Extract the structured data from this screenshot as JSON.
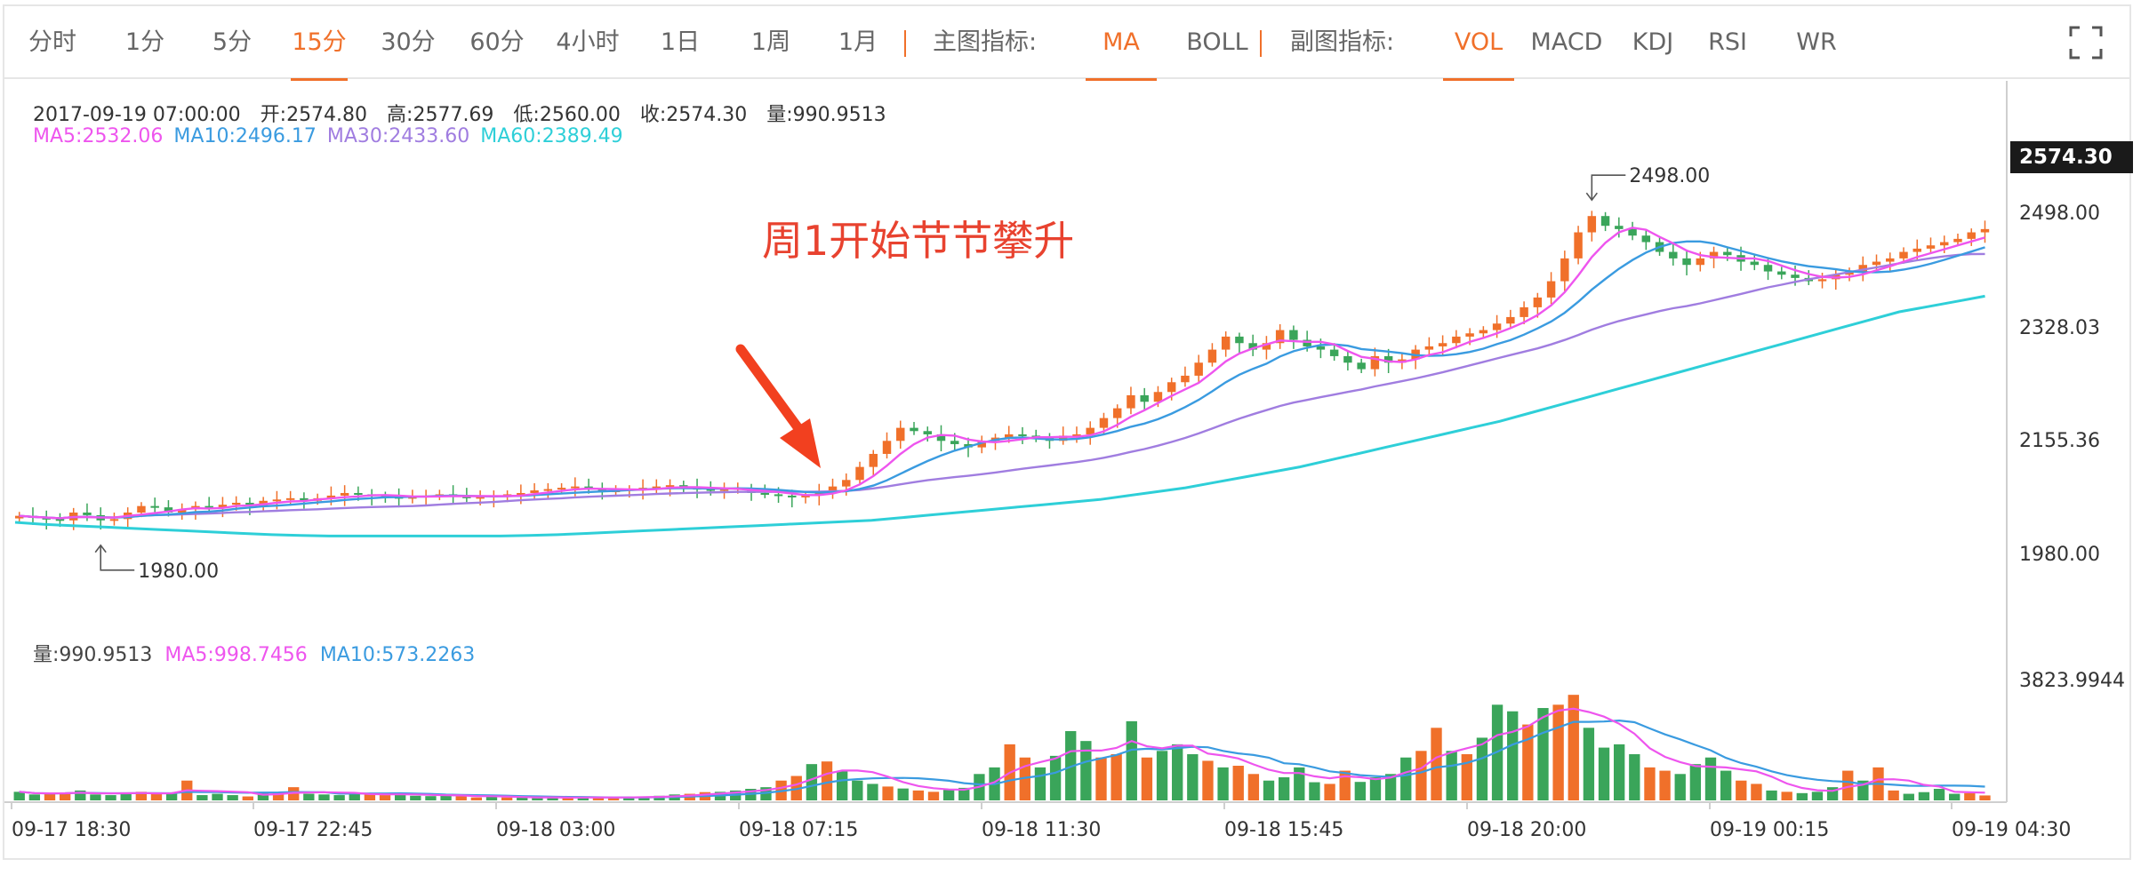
{
  "toolbar": {
    "periods": [
      {
        "label": "分时",
        "active": false
      },
      {
        "label": "1分",
        "active": false
      },
      {
        "label": "5分",
        "active": false
      },
      {
        "label": "15分",
        "active": true
      },
      {
        "label": "30分",
        "active": false
      },
      {
        "label": "60分",
        "active": false
      },
      {
        "label": "4小时",
        "active": false
      },
      {
        "label": "1日",
        "active": false
      },
      {
        "label": "1周",
        "active": false
      },
      {
        "label": "1月",
        "active": false
      }
    ],
    "main_indicator_label": "主图指标:",
    "main_indicators": [
      {
        "label": "MA",
        "active": true
      },
      {
        "label": "BOLL",
        "active": false
      }
    ],
    "sub_indicator_label": "副图指标:",
    "sub_indicators": [
      {
        "label": "VOL",
        "active": true
      },
      {
        "label": "MACD",
        "active": false
      },
      {
        "label": "KDJ",
        "active": false
      },
      {
        "label": "RSI",
        "active": false
      },
      {
        "label": "WR",
        "active": false
      }
    ],
    "fullscreen_icon": "expand-icon"
  },
  "info": {
    "line1": "2017-09-19 07:00:00　开:2574.80　高:2577.69　低:2560.00　收:2574.30　量:990.9513",
    "ma": [
      {
        "text": "MA5:2532.06",
        "color": "#ee55ee"
      },
      {
        "text": "MA10:2496.17",
        "color": "#3a9be0"
      },
      {
        "text": "MA30:2433.60",
        "color": "#a07de0"
      },
      {
        "text": "MA60:2389.49",
        "color": "#2ecfd8"
      }
    ],
    "vol": [
      {
        "text": "量:990.9513",
        "color": "#444444"
      },
      {
        "text": "MA5:998.7456",
        "color": "#ee55ee"
      },
      {
        "text": "MA10:573.2263",
        "color": "#3a9be0"
      }
    ]
  },
  "annotation": "周1开始节节攀升",
  "colors": {
    "up": "#f0702a",
    "down": "#3aa55a",
    "accent": "#f0702a",
    "arrow": "#f2401f",
    "price_tag_bg": "#1a1a1a"
  },
  "chart_data": {
    "type": "candlestick",
    "symbol_interval": "15分",
    "price_axis": {
      "ticks": [
        "2498.00",
        "2328.03",
        "2155.36",
        "1980.00"
      ],
      "current_price": "2574.30",
      "ylim": [
        1980,
        2498
      ]
    },
    "volume_axis": {
      "ticks": [
        "3823.9944"
      ],
      "ylim": [
        0,
        3823.9944
      ]
    },
    "x_ticks": [
      "09-17 18:30",
      "09-17 22:45",
      "09-18 03:00",
      "09-18 07:15",
      "09-18 11:30",
      "09-18 15:45",
      "09-18 20:00",
      "09-19 00:15",
      "09-19 04:30"
    ],
    "markers": {
      "high": "2498.00",
      "low": "1980.00"
    },
    "close_series": [
      2035,
      2032,
      2030,
      2028,
      2040,
      2036,
      2028,
      2030,
      2040,
      2050,
      2048,
      2040,
      2045,
      2050,
      2048,
      2052,
      2055,
      2050,
      2058,
      2060,
      2062,
      2058,
      2062,
      2066,
      2070,
      2068,
      2066,
      2064,
      2062,
      2064,
      2066,
      2068,
      2066,
      2062,
      2064,
      2066,
      2068,
      2070,
      2074,
      2076,
      2078,
      2080,
      2076,
      2072,
      2074,
      2076,
      2078,
      2080,
      2082,
      2078,
      2076,
      2074,
      2076,
      2078,
      2070,
      2068,
      2066,
      2064,
      2066,
      2070,
      2080,
      2090,
      2110,
      2130,
      2150,
      2170,
      2165,
      2160,
      2150,
      2145,
      2140,
      2150,
      2155,
      2160,
      2158,
      2155,
      2150,
      2158,
      2160,
      2170,
      2185,
      2200,
      2220,
      2210,
      2225,
      2240,
      2250,
      2270,
      2290,
      2310,
      2300,
      2290,
      2300,
      2320,
      2305,
      2295,
      2290,
      2280,
      2270,
      2260,
      2280,
      2270,
      2275,
      2290,
      2295,
      2300,
      2310,
      2315,
      2320,
      2330,
      2340,
      2355,
      2370,
      2395,
      2430,
      2470,
      2495,
      2480,
      2475,
      2465,
      2455,
      2440,
      2430,
      2420,
      2430,
      2440,
      2435,
      2425,
      2420,
      2410,
      2405,
      2400,
      2395,
      2398,
      2405,
      2410,
      2420,
      2425,
      2430,
      2440,
      2445,
      2450,
      2455,
      2460,
      2470,
      2475
    ],
    "ma60_series": [
      2025,
      2022,
      2020,
      2018,
      2016,
      2014,
      2012,
      2010,
      2008,
      2006,
      2005,
      2004,
      2004,
      2004,
      2004,
      2004,
      2004,
      2004,
      2005,
      2006,
      2008,
      2010,
      2012,
      2014,
      2016,
      2018,
      2020,
      2022,
      2024,
      2026,
      2028,
      2032,
      2036,
      2040,
      2044,
      2048,
      2052,
      2056,
      2060,
      2066,
      2072,
      2078,
      2086,
      2094,
      2102,
      2110,
      2120,
      2130,
      2140,
      2150,
      2160,
      2170,
      2180,
      2192,
      2204,
      2216,
      2228,
      2240,
      2252,
      2264,
      2276,
      2288,
      2300,
      2312,
      2324,
      2336,
      2348,
      2356,
      2364,
      2372
    ],
    "volume_series": [
      260,
      180,
      200,
      220,
      300,
      180,
      160,
      220,
      260,
      240,
      200,
      600,
      160,
      200,
      160,
      120,
      220,
      240,
      400,
      200,
      180,
      160,
      200,
      220,
      160,
      180,
      140,
      130,
      170,
      130,
      90,
      110,
      90,
      90,
      80,
      90,
      80,
      90,
      100,
      80,
      100,
      110,
      140,
      180,
      200,
      250,
      260,
      300,
      350,
      400,
      600,
      740,
      1100,
      1180,
      900,
      600,
      500,
      420,
      360,
      300,
      260,
      320,
      380,
      800,
      1000,
      1700,
      1300,
      1000,
      1350,
      2100,
      1800,
      1300,
      1400,
      2400,
      1300,
      1500,
      1700,
      1400,
      1200,
      1000,
      1050,
      800,
      600,
      700,
      1000,
      550,
      500,
      900,
      560,
      700,
      800,
      1300,
      1500,
      2200,
      1500,
      1400,
      1900,
      2900,
      2700,
      2300,
      2800,
      2900,
      3200,
      2200,
      1600,
      1700,
      1400,
      1000,
      900,
      800,
      1100,
      1300,
      900,
      600,
      500,
      300,
      260,
      220,
      260,
      400,
      900,
      600,
      1000,
      300,
      200,
      250,
      350,
      200,
      220,
      150
    ],
    "legend": [
      {
        "name": "MA5",
        "color": "#ee55ee"
      },
      {
        "name": "MA10",
        "color": "#3a9be0"
      },
      {
        "name": "MA30",
        "color": "#a07de0"
      },
      {
        "name": "MA60",
        "color": "#2ecfd8"
      }
    ]
  }
}
